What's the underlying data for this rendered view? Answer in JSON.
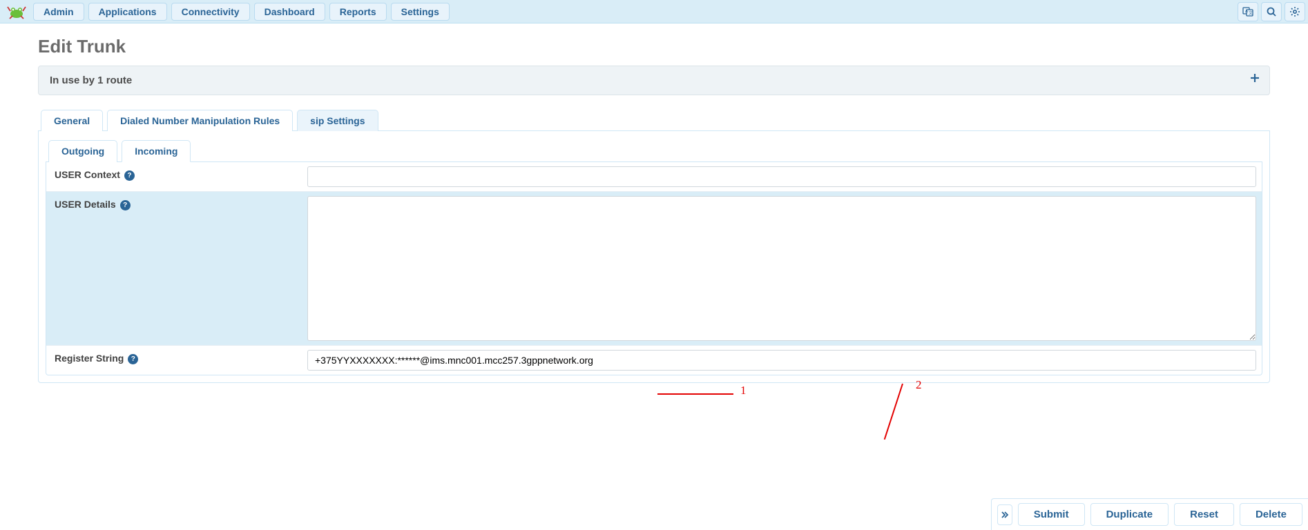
{
  "nav": {
    "items": [
      "Admin",
      "Applications",
      "Connectivity",
      "Dashboard",
      "Reports",
      "Settings"
    ]
  },
  "page": {
    "title": "Edit Trunk",
    "banner": "In use by 1 route"
  },
  "tabs": {
    "main": [
      {
        "label": "General"
      },
      {
        "label": "Dialed Number Manipulation Rules"
      },
      {
        "label": "sip Settings"
      }
    ],
    "sub": [
      {
        "label": "Outgoing"
      },
      {
        "label": "Incoming"
      }
    ]
  },
  "form": {
    "user_context_label": "USER Context",
    "user_context_value": "",
    "user_details_label": "USER Details",
    "user_details_value": "",
    "register_string_label": "Register String",
    "register_string_value": "+375YYXXXXXXX:******@ims.mnc001.mcc257.3gppnetwork.org"
  },
  "annotations": {
    "one": "1",
    "two": "2"
  },
  "actions": {
    "submit": "Submit",
    "duplicate": "Duplicate",
    "reset": "Reset",
    "delete": "Delete"
  }
}
